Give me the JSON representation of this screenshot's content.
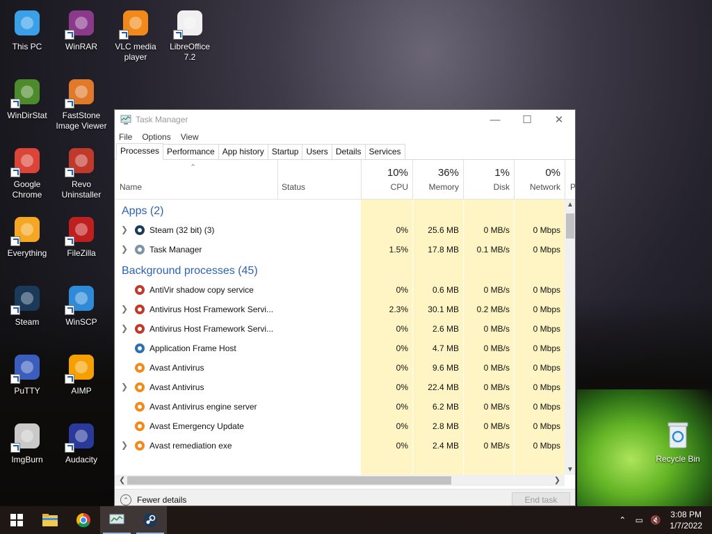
{
  "desktop": {
    "icons": [
      {
        "label": "This PC",
        "icon": "this-pc-icon"
      },
      {
        "label": "WinRAR",
        "icon": "winrar-icon"
      },
      {
        "label": "VLC media player",
        "icon": "vlc-icon"
      },
      {
        "label": "LibreOffice 7.2",
        "icon": "libreoffice-icon"
      },
      {
        "label": "WinDirStat",
        "icon": "windirstat-icon"
      },
      {
        "label": "FastStone Image Viewer",
        "icon": "faststone-icon"
      },
      {
        "label": "Google Chrome",
        "icon": "chrome-icon"
      },
      {
        "label": "Revo Uninstaller",
        "icon": "revo-icon"
      },
      {
        "label": "Everything",
        "icon": "everything-icon"
      },
      {
        "label": "FileZilla",
        "icon": "filezilla-icon"
      },
      {
        "label": "Steam",
        "icon": "steam-icon"
      },
      {
        "label": "WinSCP",
        "icon": "winscp-icon"
      },
      {
        "label": "PuTTY",
        "icon": "putty-icon"
      },
      {
        "label": "AIMP",
        "icon": "aimp-icon"
      },
      {
        "label": "ImgBurn",
        "icon": "imgburn-icon"
      },
      {
        "label": "Audacity",
        "icon": "audacity-icon"
      }
    ],
    "recycle_bin": "Recycle Bin"
  },
  "task_manager": {
    "title": "Task Manager",
    "menu": [
      "File",
      "Options",
      "View"
    ],
    "tabs": [
      "Processes",
      "Performance",
      "App history",
      "Startup",
      "Users",
      "Details",
      "Services"
    ],
    "active_tab": "Processes",
    "columns": {
      "name": "Name",
      "status": "Status",
      "cpu": {
        "pct": "10%",
        "label": "CPU"
      },
      "memory": {
        "pct": "36%",
        "label": "Memory"
      },
      "disk": {
        "pct": "1%",
        "label": "Disk"
      },
      "network": {
        "pct": "0%",
        "label": "Network"
      },
      "power_partial": "P"
    },
    "groups": {
      "apps": "Apps (2)",
      "background": "Background processes (45)"
    },
    "apps": [
      {
        "name": "Steam (32 bit) (3)",
        "expandable": true,
        "cpu": "0%",
        "memory": "25.6 MB",
        "disk": "0 MB/s",
        "network": "0 Mbps"
      },
      {
        "name": "Task Manager",
        "expandable": true,
        "cpu": "1.5%",
        "memory": "17.8 MB",
        "disk": "0.1 MB/s",
        "network": "0 Mbps"
      }
    ],
    "background": [
      {
        "name": "AntiVir shadow copy service",
        "expandable": false,
        "cpu": "0%",
        "memory": "0.6 MB",
        "disk": "0 MB/s",
        "network": "0 Mbps"
      },
      {
        "name": "Antivirus Host Framework Servi...",
        "expandable": true,
        "cpu": "2.3%",
        "memory": "30.1 MB",
        "disk": "0.2 MB/s",
        "network": "0 Mbps"
      },
      {
        "name": "Antivirus Host Framework Servi...",
        "expandable": true,
        "cpu": "0%",
        "memory": "2.6 MB",
        "disk": "0 MB/s",
        "network": "0 Mbps"
      },
      {
        "name": "Application Frame Host",
        "expandable": false,
        "cpu": "0%",
        "memory": "4.7 MB",
        "disk": "0 MB/s",
        "network": "0 Mbps"
      },
      {
        "name": "Avast Antivirus",
        "expandable": false,
        "cpu": "0%",
        "memory": "9.6 MB",
        "disk": "0 MB/s",
        "network": "0 Mbps"
      },
      {
        "name": "Avast Antivirus",
        "expandable": true,
        "cpu": "0%",
        "memory": "22.4 MB",
        "disk": "0 MB/s",
        "network": "0 Mbps"
      },
      {
        "name": "Avast Antivirus engine server",
        "expandable": false,
        "cpu": "0%",
        "memory": "6.2 MB",
        "disk": "0 MB/s",
        "network": "0 Mbps"
      },
      {
        "name": "Avast Emergency Update",
        "expandable": false,
        "cpu": "0%",
        "memory": "2.8 MB",
        "disk": "0 MB/s",
        "network": "0 Mbps"
      },
      {
        "name": "Avast remediation exe",
        "expandable": true,
        "cpu": "0%",
        "memory": "2.4 MB",
        "disk": "0 MB/s",
        "network": "0 Mbps"
      }
    ],
    "footer": {
      "fewer_details": "Fewer details",
      "end_task": "End task"
    }
  },
  "taskbar": {
    "time": "3:08 PM",
    "date": "1/7/2022"
  }
}
